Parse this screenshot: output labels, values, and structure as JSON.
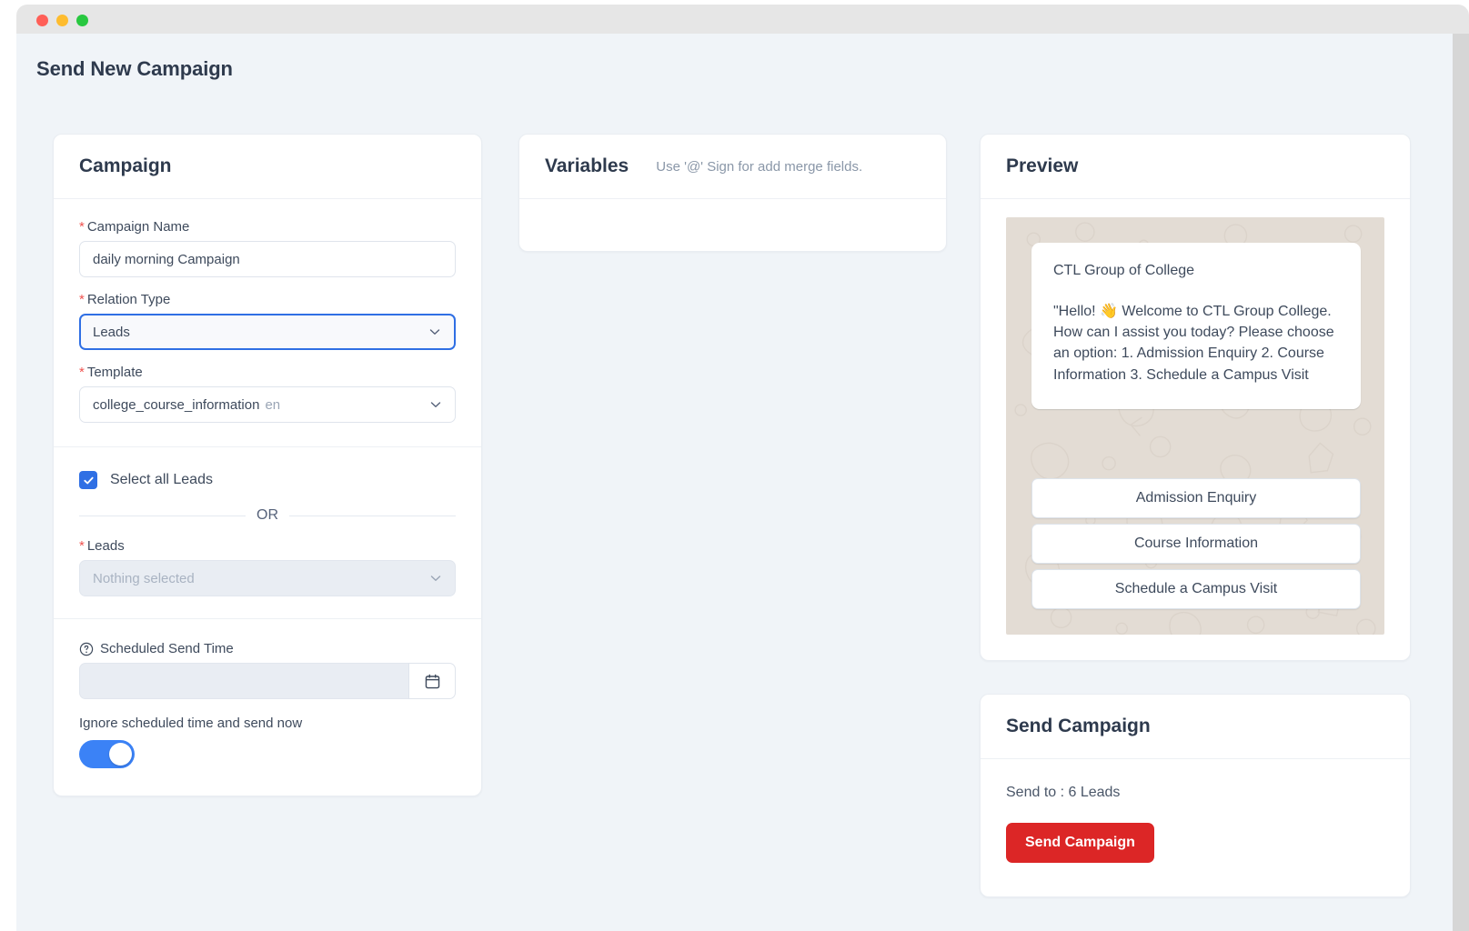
{
  "window": {
    "traffic_lights": [
      "close",
      "minimize",
      "zoom"
    ],
    "colors": {
      "close": "#ff5f57",
      "minimize": "#febc2e",
      "zoom": "#28c840",
      "accent_blue": "#2f6fe4",
      "toggle_blue": "#3b82f6",
      "danger_red": "#dc2626",
      "required_red": "#ef5350",
      "page_bg": "#f0f4f8",
      "whatsapp_bg": "#e3dcd4"
    }
  },
  "page": {
    "title": "Send New Campaign"
  },
  "campaign_card": {
    "title": "Campaign",
    "campaign_name": {
      "label": "Campaign Name",
      "required_marker": "*",
      "value": "daily morning Campaign",
      "placeholder": ""
    },
    "relation_type": {
      "label": "Relation Type",
      "required_marker": "*",
      "value": "Leads"
    },
    "template": {
      "label": "Template",
      "required_marker": "*",
      "value": "college_course_information",
      "language": "en"
    },
    "select_all": {
      "label": "Select all Leads",
      "checked": true
    },
    "or_text": "OR",
    "leads": {
      "label": "Leads",
      "required_marker": "*",
      "placeholder": "Nothing selected",
      "value": ""
    },
    "scheduled_send_time": {
      "label": "Scheduled Send Time",
      "value": "",
      "placeholder": ""
    },
    "ignore_schedule": {
      "label": "Ignore scheduled time and send now",
      "enabled": true
    }
  },
  "variables_card": {
    "title": "Variables",
    "hint": "Use '@' Sign for add merge fields."
  },
  "preview_card": {
    "title": "Preview",
    "message": {
      "header": "CTL Group of College",
      "body": "\"Hello! 👋 Welcome to CTL Group College. How can I assist you today? Please choose an option: 1. Admission Enquiry 2. Course Information 3. Schedule a Campus Visit"
    },
    "buttons": [
      "Admission Enquiry",
      "Course Information",
      "Schedule a Campus Visit"
    ]
  },
  "send_card": {
    "title": "Send Campaign",
    "send_to": "Send to : 6 Leads",
    "button_label": "Send Campaign"
  }
}
